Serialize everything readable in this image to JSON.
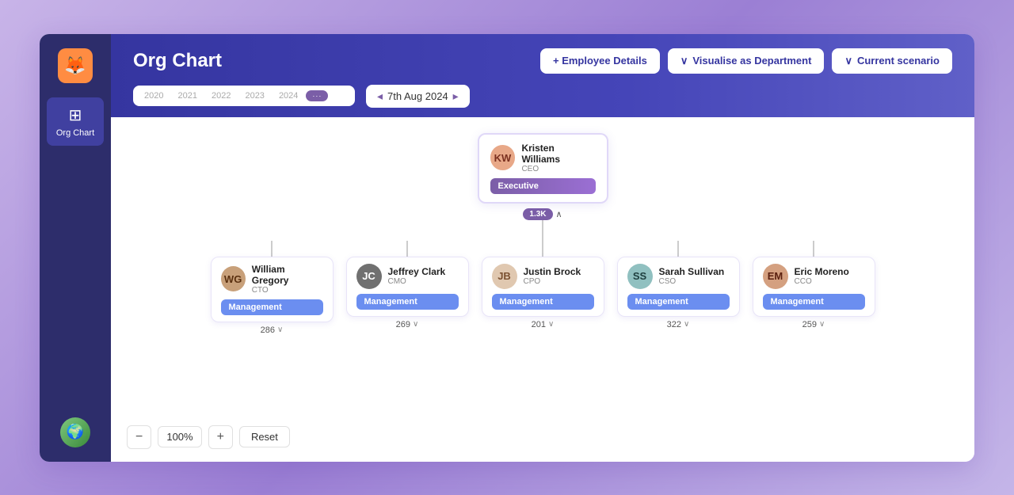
{
  "app": {
    "title": "Org Chart",
    "logo_icon": "🦊"
  },
  "sidebar": {
    "nav_items": [
      {
        "id": "org-chart",
        "label": "Org Chart",
        "icon": "⊞",
        "active": true
      }
    ],
    "user_avatar": "🌍"
  },
  "header": {
    "title": "Org Chart",
    "timeline": {
      "years": [
        "2020",
        "2021",
        "2022",
        "2023",
        "2024"
      ]
    },
    "date_selector": {
      "arrow_left": "◂",
      "date": "7th Aug 2024",
      "arrow_right": "▸"
    },
    "buttons": {
      "employee_details": "+ Employee Details",
      "visualise": "Visualise as Department",
      "scenario": "Current scenario"
    }
  },
  "ceo": {
    "name": "Kristen Williams",
    "role": "CEO",
    "dept": "Executive",
    "count": "1.3K",
    "avatar_initials": "KW"
  },
  "children": [
    {
      "name": "William Gregory",
      "role": "CTO",
      "dept": "Management",
      "count": "286",
      "initials": "WG"
    },
    {
      "name": "Jeffrey Clark",
      "role": "CMO",
      "dept": "Management",
      "count": "269",
      "initials": "JC"
    },
    {
      "name": "Justin Brock",
      "role": "CPO",
      "dept": "Management",
      "count": "201",
      "initials": "JB"
    },
    {
      "name": "Sarah Sullivan",
      "role": "CSO",
      "dept": "Management",
      "count": "322",
      "initials": "SS"
    },
    {
      "name": "Eric Moreno",
      "role": "CCO",
      "dept": "Management",
      "count": "259",
      "initials": "EM"
    }
  ],
  "zoom": {
    "value": "100%",
    "minus": "−",
    "plus": "+",
    "reset": "Reset"
  }
}
